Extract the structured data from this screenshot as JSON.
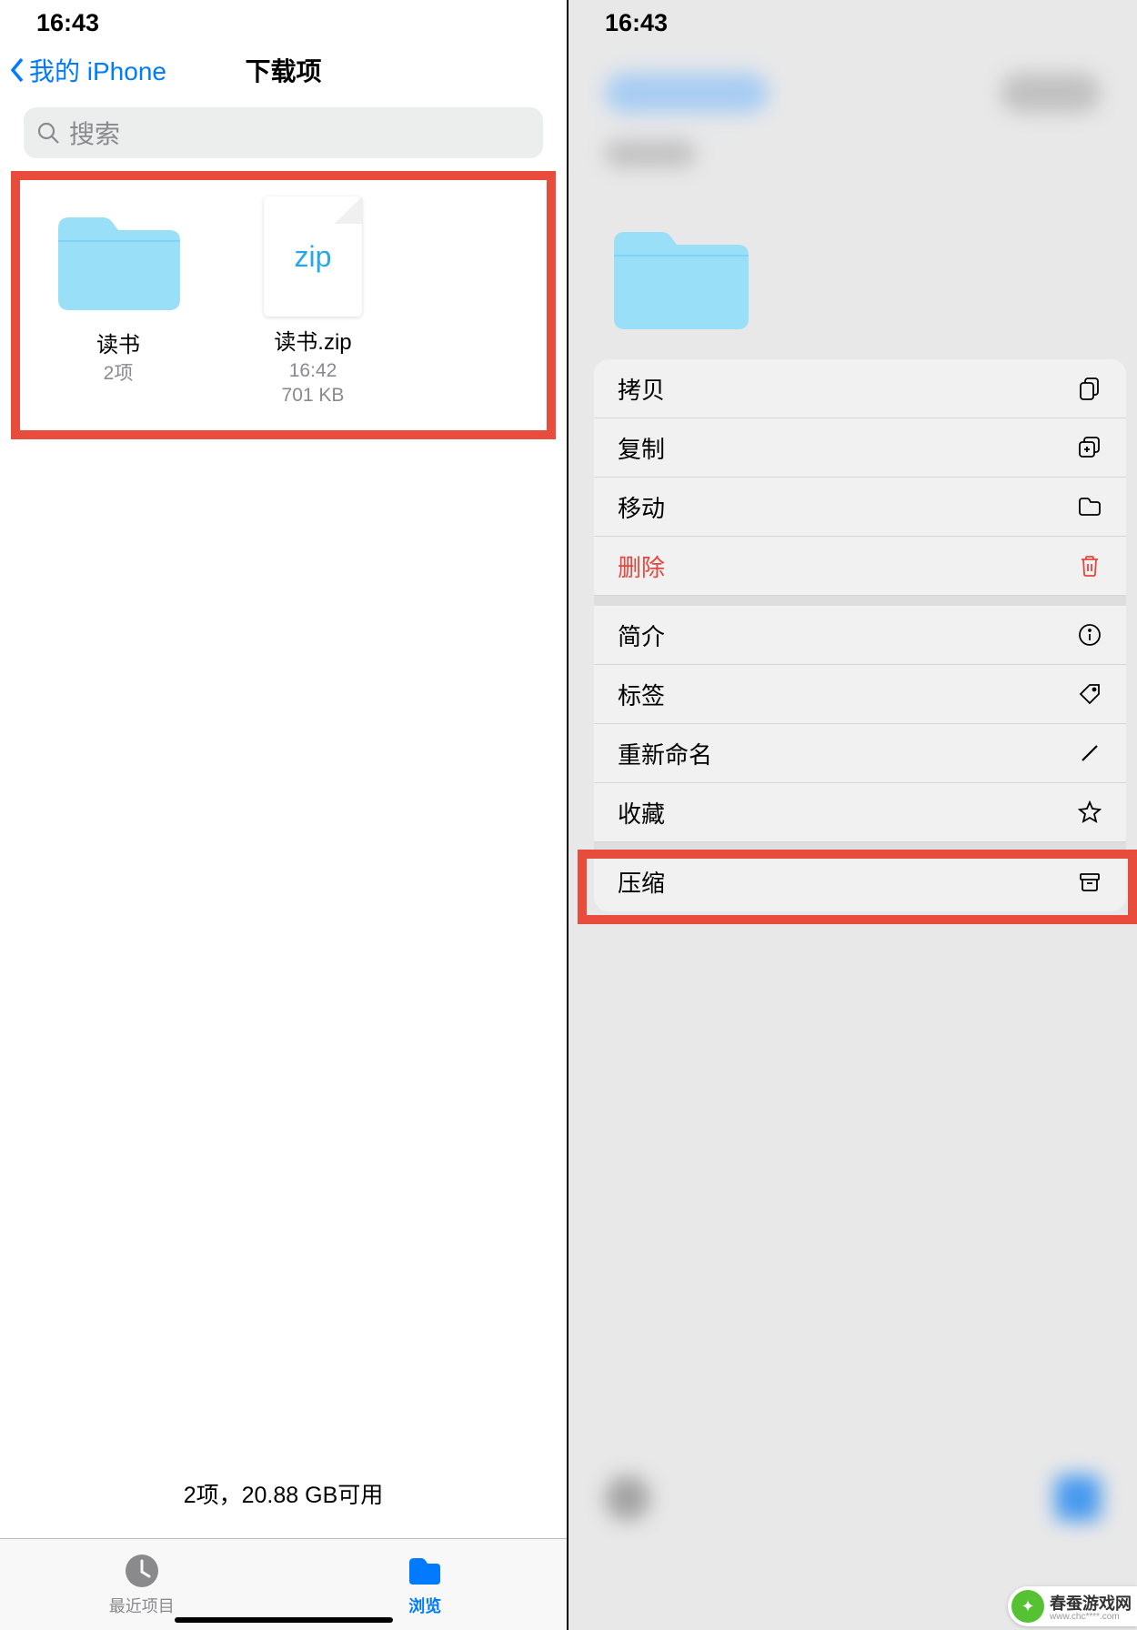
{
  "left": {
    "status_time": "16:43",
    "back_label": "我的 iPhone",
    "title": "下载项",
    "search_placeholder": "搜索",
    "folder": {
      "name": "读书",
      "meta": "2项"
    },
    "zip": {
      "name": "读书.zip",
      "time": "16:42",
      "size": "701 KB",
      "badge": "zip"
    },
    "storage": "2项，20.88 GB可用",
    "tabs": {
      "recent": "最近项目",
      "browse": "浏览"
    }
  },
  "right": {
    "status_time": "16:43",
    "menu": {
      "copy": "拷贝",
      "duplicate": "复制",
      "move": "移动",
      "delete": "删除",
      "info": "简介",
      "tags": "标签",
      "rename": "重新命名",
      "favorite": "收藏",
      "compress": "压缩"
    }
  },
  "watermark": {
    "title": "春蚕游戏网",
    "sub": "www.chc****.com"
  }
}
